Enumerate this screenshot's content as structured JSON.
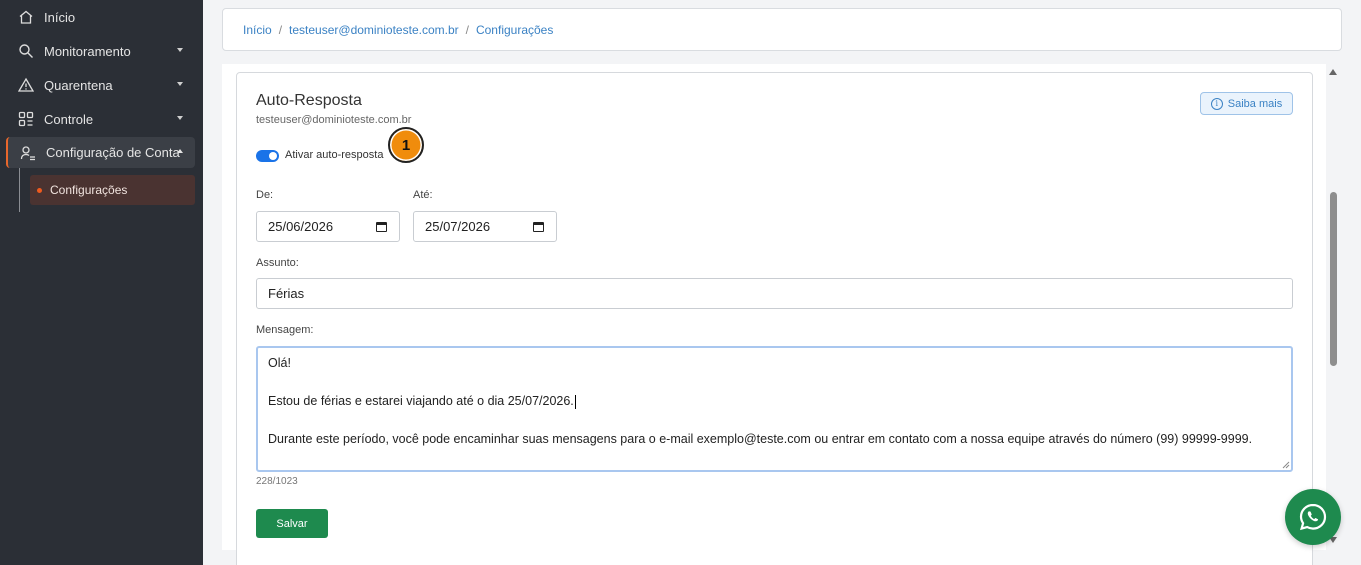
{
  "sidebar": {
    "items": [
      {
        "label": "Início",
        "icon": "home-icon"
      },
      {
        "label": "Monitoramento",
        "icon": "search-icon"
      },
      {
        "label": "Quarentena",
        "icon": "warning-icon"
      },
      {
        "label": "Controle",
        "icon": "grid-icon"
      },
      {
        "label": "Configuração de Conta",
        "icon": "user-settings-icon"
      }
    ],
    "subitem": "Configurações"
  },
  "breadcrumb": {
    "home": "Início",
    "account": "testeuser@dominioteste.com.br",
    "current": "Configurações",
    "separator": "/"
  },
  "card": {
    "title": "Auto-Resposta",
    "subtitle": "testeuser@dominioteste.com.br",
    "help_button": "Saiba mais",
    "toggle_label": "Ativar auto-resposta",
    "toggle_on": true,
    "step_badge": "1"
  },
  "form": {
    "from_label": "De:",
    "from_value": "25/06/2026",
    "to_label": "Até:",
    "to_value": "25/07/2026",
    "subject_label": "Assunto:",
    "subject_value": "Férias",
    "message_label": "Mensagem:",
    "message_lines": [
      "Olá!",
      "",
      "Estou de férias e estarei viajando até o dia 25/07/2026.",
      "",
      "Durante este período, você pode encaminhar suas mensagens para o e-mail exemplo@teste.com ou entrar em contato com a nossa equipe através do número (99) 99999-9999."
    ],
    "char_counter": "228/1023",
    "save_label": "Salvar"
  },
  "colors": {
    "sidebar_bg": "#2b2f36",
    "accent_orange": "#ef5a1e",
    "link_blue": "#3b82c4",
    "toggle_blue": "#1a73e8",
    "save_green": "#1e8a4e"
  }
}
